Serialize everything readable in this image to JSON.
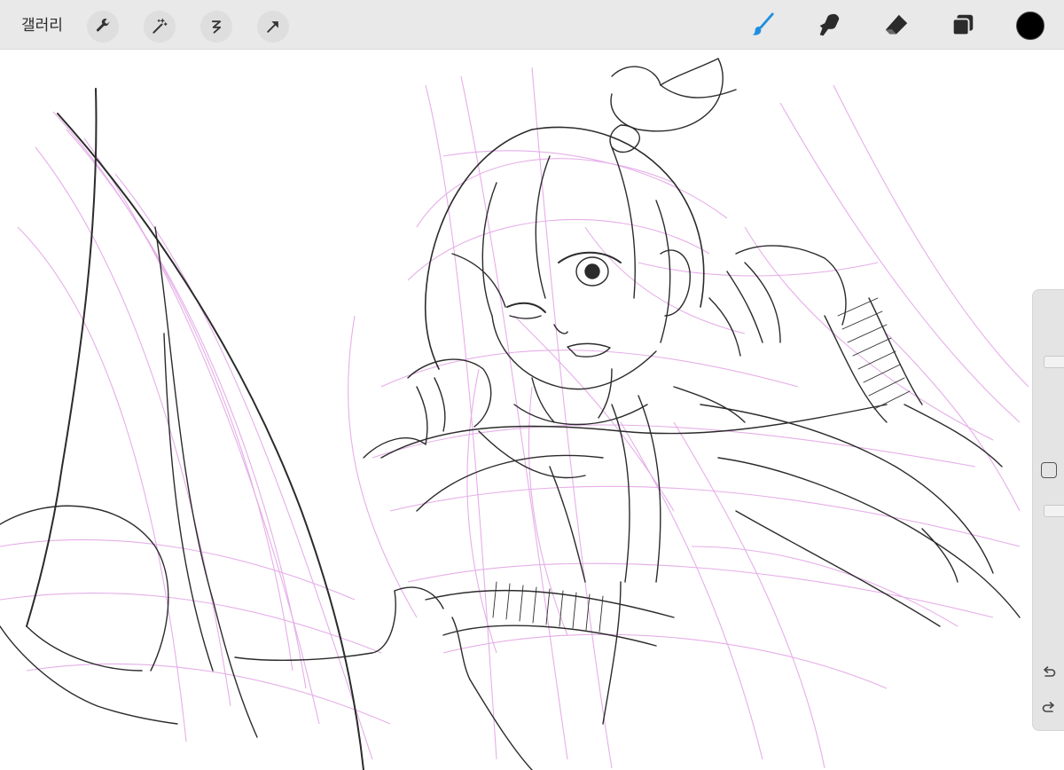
{
  "toolbar": {
    "gallery_label": "갤러리",
    "left_tools": [
      "wrench-icon",
      "magic-wand-icon",
      "selection-s-icon",
      "transform-arrow-icon"
    ],
    "right_tools": [
      "brush-icon",
      "smudge-icon",
      "eraser-icon",
      "layers-icon"
    ],
    "active_tool": "brush",
    "active_tool_color": "#1e8fe0",
    "current_color": "#000000"
  },
  "sidebar": {
    "brush_size_level": 0.55,
    "opacity_level": 1.0,
    "icons": [
      "modify-square-icon",
      "undo-icon",
      "redo-icon"
    ]
  },
  "canvas": {
    "background": "#ffffff",
    "ink_color": "#2b2b2b",
    "rough_sketch_color": "#e3a6e6"
  }
}
